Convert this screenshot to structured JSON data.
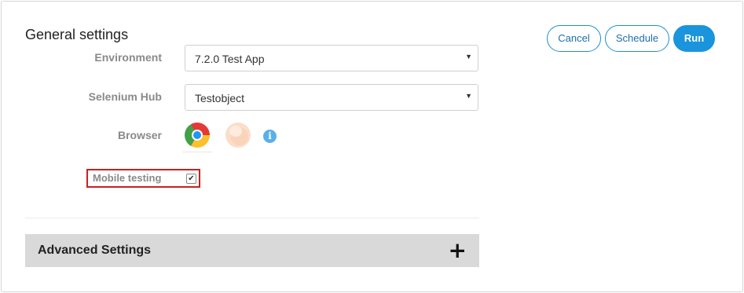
{
  "header": {
    "title": "General settings"
  },
  "actions": {
    "cancel": "Cancel",
    "schedule": "Schedule",
    "run": "Run"
  },
  "environment": {
    "label": "Environment",
    "value": "7.2.0 Test App"
  },
  "selenium_hub": {
    "label": "Selenium Hub",
    "value": "Testobject"
  },
  "browser": {
    "label": "Browser",
    "icons": [
      "chrome-icon",
      "firefox-icon",
      "info-icon"
    ],
    "info_glyph": "i"
  },
  "mobile_testing": {
    "label": "Mobile testing",
    "checked": true
  },
  "advanced": {
    "title": "Advanced Settings",
    "expand_glyph": "+"
  },
  "colors": {
    "accent": "#1a94dc",
    "highlight_border": "#cc1f1f",
    "panel_bg": "#d9d9d9"
  }
}
